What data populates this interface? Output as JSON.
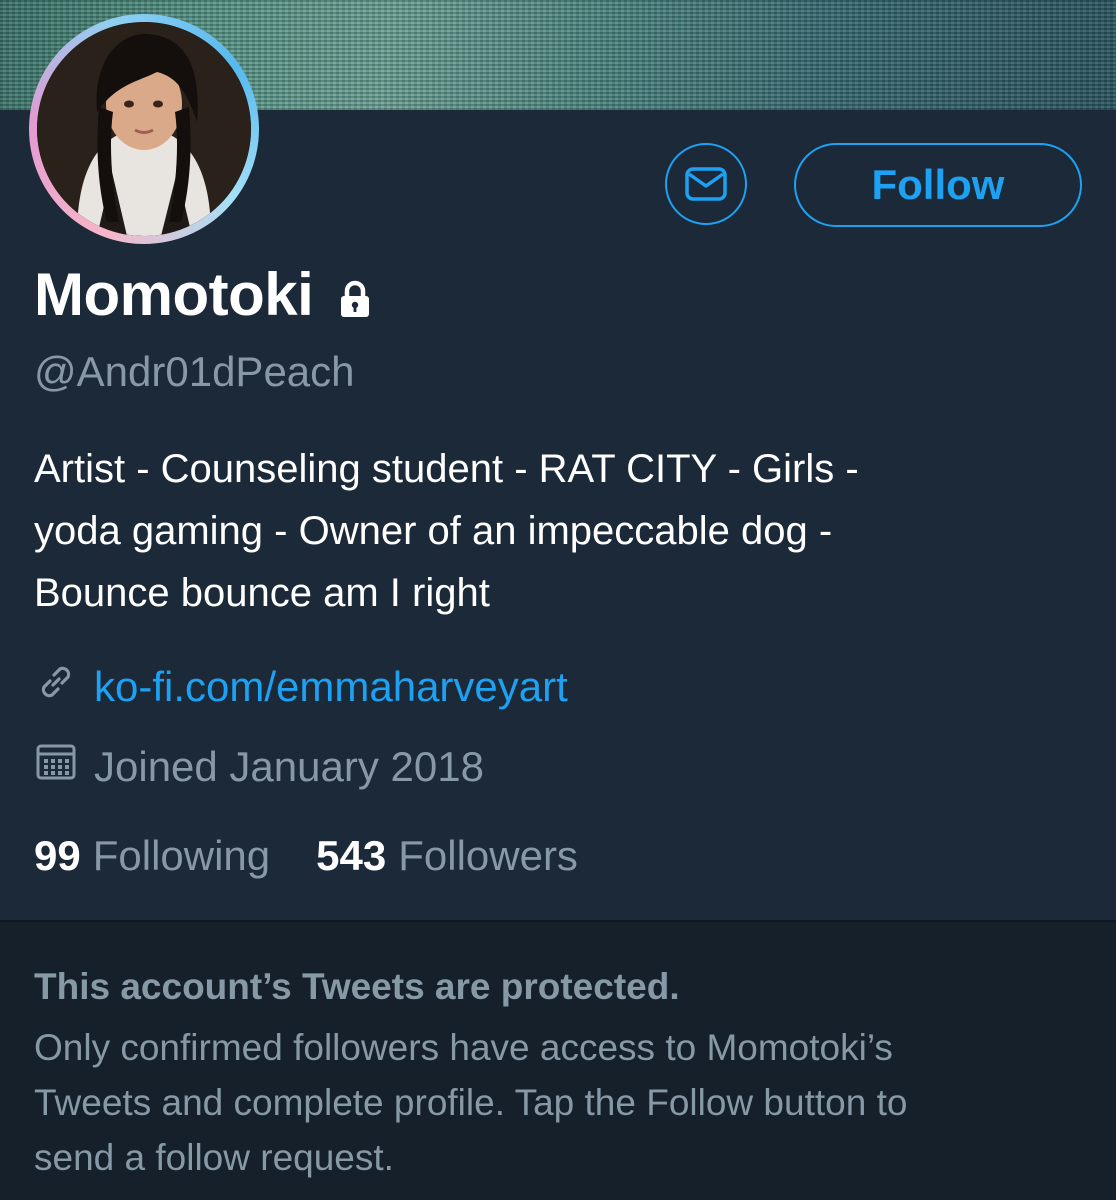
{
  "profile": {
    "display_name": "Momotoki",
    "handle": "@Andr01dPeach",
    "bio_lines": [
      "Artist - Counseling student - RAT CITY - Girls -",
      "yoda gaming - Owner of an impeccable dog -",
      "Bounce bounce am I right"
    ],
    "link": "ko-fi.com/emmaharveyart",
    "joined": "Joined January 2018",
    "stats": {
      "following_count": "99",
      "following_label": "Following",
      "followers_count": "543",
      "followers_label": "Followers"
    }
  },
  "actions": {
    "follow_label": "Follow"
  },
  "protected_notice": {
    "title": "This account’s Tweets are protected.",
    "body_lines": [
      "Only confirmed followers have access to Momotoki’s",
      "Tweets and complete profile. Tap the Follow button to",
      "send a follow request."
    ]
  },
  "icons": {
    "lock": "lock-icon",
    "mail": "mail-icon",
    "link": "link-icon",
    "calendar": "calendar-icon"
  },
  "colors": {
    "accent": "#1da1f2",
    "background": "#1c2938",
    "secondary_text": "#8899a6",
    "notice_background": "#15202b"
  }
}
